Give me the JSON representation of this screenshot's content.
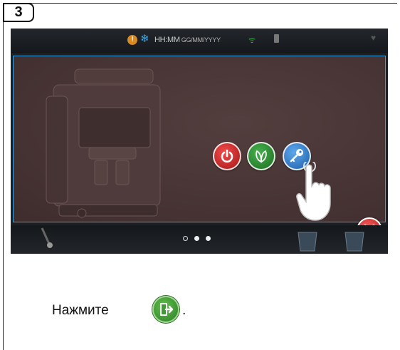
{
  "step": {
    "number": "3"
  },
  "status_bar": {
    "time": "HH:MM",
    "date": "GG/MM/YYYY",
    "icons": [
      "warning-icon",
      "snowflake-icon",
      "wifi-icon",
      "battery-icon",
      "heart-icon"
    ]
  },
  "panel": {
    "buttons": [
      {
        "name": "power",
        "icon": "power-icon",
        "color": "#c92424"
      },
      {
        "name": "eco",
        "icon": "leaf-icon",
        "color": "#2e8a33"
      },
      {
        "name": "key",
        "icon": "key-icon",
        "color": "#2f78c4"
      }
    ],
    "close": {
      "icon": "close-icon",
      "color": "#d02a2a"
    },
    "border_color": "#3fa1dc",
    "background_color": "#4a3434"
  },
  "pager": {
    "total": 3,
    "active": 1
  },
  "instruction": {
    "text": "Нажмите",
    "end": ".",
    "icon": "exit-icon",
    "icon_color": "#3d9a34"
  }
}
